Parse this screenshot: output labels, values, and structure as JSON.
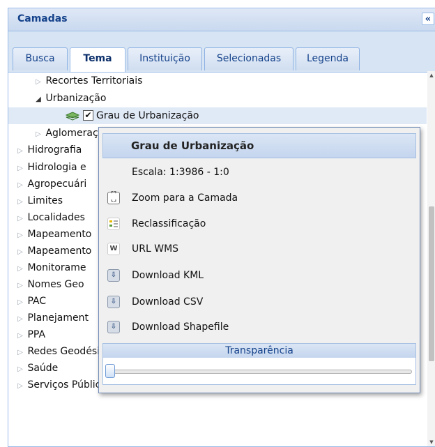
{
  "panel": {
    "title": "Camadas",
    "collapse_glyph": "«"
  },
  "tabs": [
    {
      "label": "Busca"
    },
    {
      "label": "Tema",
      "active": true
    },
    {
      "label": "Instituição"
    },
    {
      "label": "Selecionadas"
    },
    {
      "label": "Legenda"
    }
  ],
  "tree": {
    "rows": [
      {
        "label": "Recortes Territoriais",
        "expanded": false
      },
      {
        "label": "Urbanização",
        "expanded": true
      },
      {
        "label": "Grau de Urbanização",
        "checked": true,
        "layer_icon": "layers-icon",
        "selected": true
      },
      {
        "label": "Aglomerações"
      },
      {
        "label": "Hidrografia"
      },
      {
        "label": "Hidrologia e"
      },
      {
        "label": "Agropecuári"
      },
      {
        "label": "Limites"
      },
      {
        "label": "Localidades"
      },
      {
        "label": "Mapeamento"
      },
      {
        "label": "Mapeamento"
      },
      {
        "label": "Monitorame"
      },
      {
        "label": "Nomes Geo"
      },
      {
        "label": "PAC"
      },
      {
        "label": "Planejament"
      },
      {
        "label": "PPA"
      },
      {
        "label": "Redes Geodésicas"
      },
      {
        "label": "Saúde"
      },
      {
        "label": "Serviços Públicos"
      }
    ]
  },
  "context_menu": {
    "title": "Grau de Urbanização",
    "scale": "Escala: 1:3986 - 1:0",
    "items": [
      {
        "label": "Zoom para a Camada",
        "icon": "zoom-layer-icon"
      },
      {
        "label": "Reclassificação",
        "icon": "reclassify-icon"
      },
      {
        "label": "URL WMS",
        "icon": "wms-icon",
        "glyph": "W"
      },
      {
        "label": "Download KML",
        "icon": "download-icon"
      },
      {
        "label": "Download CSV",
        "icon": "download-icon"
      },
      {
        "label": "Download Shapefile",
        "icon": "download-icon"
      }
    ],
    "transparency": {
      "label": "Transparência",
      "value_percent": 0
    }
  },
  "colors": {
    "accent": "#15428b",
    "header_bg": "#dfe8f6",
    "border": "#99bbe8",
    "selected_bg": "#e0e9f6"
  }
}
